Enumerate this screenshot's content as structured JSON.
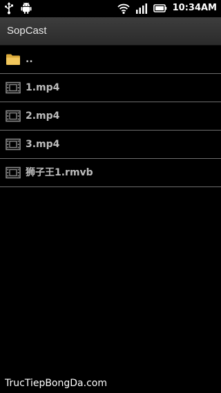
{
  "status_bar": {
    "icons": [
      "usb-icon",
      "android-debug-icon",
      "wifi-icon",
      "signal-icon",
      "battery-icon"
    ],
    "time": "10:34AM"
  },
  "app": {
    "title": "SopCast"
  },
  "file_list": [
    {
      "icon": "folder-icon",
      "label": ".."
    },
    {
      "icon": "film-icon",
      "label": "1.mp4"
    },
    {
      "icon": "film-icon",
      "label": "2.mp4"
    },
    {
      "icon": "film-icon",
      "label": "3.mp4"
    },
    {
      "icon": "film-icon",
      "label": "狮子王1.rmvb"
    }
  ],
  "colors": {
    "background": "#000000",
    "title_bar": "#333333",
    "row_text": "#bdbdbd",
    "divider": "#6e6e6e",
    "folder": "#f2c75c"
  },
  "watermark": "TrucTiepBongDa.com"
}
